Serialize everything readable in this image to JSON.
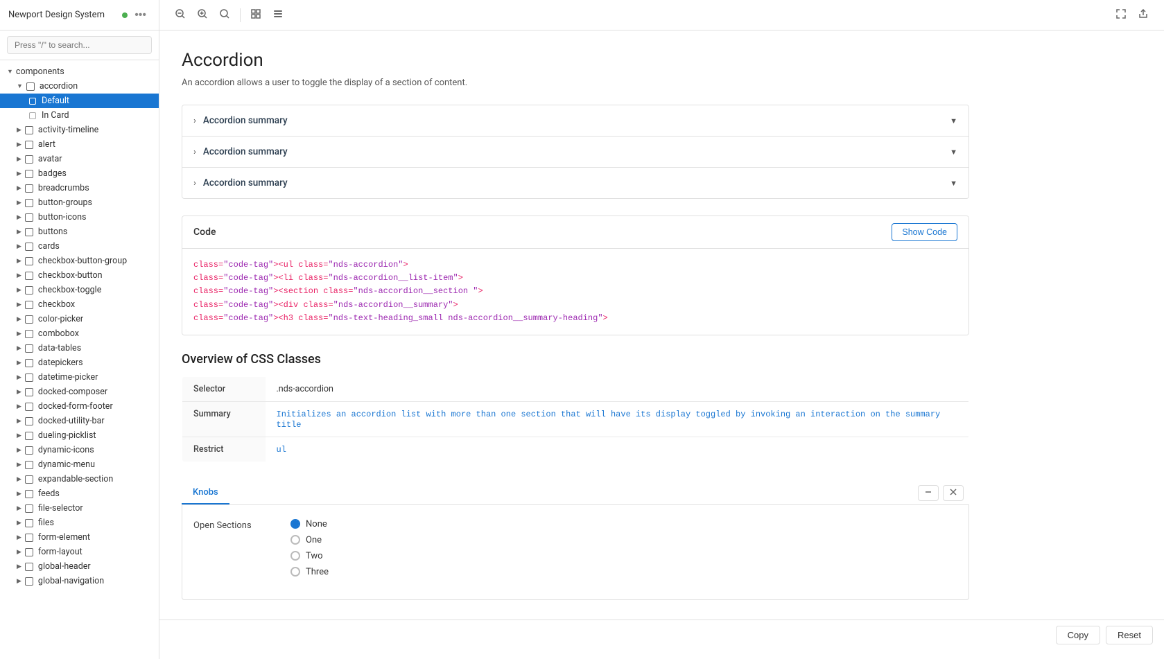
{
  "sidebar": {
    "title": "Newport Design System",
    "search_placeholder": "Press \"/\" to search...",
    "items": [
      {
        "id": "components",
        "label": "components",
        "level": 0,
        "type": "section",
        "expanded": true
      },
      {
        "id": "accordion",
        "label": "accordion",
        "level": 1,
        "type": "component",
        "expanded": true
      },
      {
        "id": "default",
        "label": "Default",
        "level": 2,
        "type": "story",
        "active": true
      },
      {
        "id": "in-card",
        "label": "In Card",
        "level": 2,
        "type": "story"
      },
      {
        "id": "activity-timeline",
        "label": "activity-timeline",
        "level": 1,
        "type": "component"
      },
      {
        "id": "alert",
        "label": "alert",
        "level": 1,
        "type": "component"
      },
      {
        "id": "avatar",
        "label": "avatar",
        "level": 1,
        "type": "component"
      },
      {
        "id": "badges",
        "label": "badges",
        "level": 1,
        "type": "component"
      },
      {
        "id": "breadcrumbs",
        "label": "breadcrumbs",
        "level": 1,
        "type": "component"
      },
      {
        "id": "button-groups",
        "label": "button-groups",
        "level": 1,
        "type": "component"
      },
      {
        "id": "button-icons",
        "label": "button-icons",
        "level": 1,
        "type": "component"
      },
      {
        "id": "buttons",
        "label": "buttons",
        "level": 1,
        "type": "component"
      },
      {
        "id": "cards",
        "label": "cards",
        "level": 1,
        "type": "component"
      },
      {
        "id": "checkbox-button-group",
        "label": "checkbox-button-group",
        "level": 1,
        "type": "component"
      },
      {
        "id": "checkbox-button",
        "label": "checkbox-button",
        "level": 1,
        "type": "component"
      },
      {
        "id": "checkbox-toggle",
        "label": "checkbox-toggle",
        "level": 1,
        "type": "component"
      },
      {
        "id": "checkbox",
        "label": "checkbox",
        "level": 1,
        "type": "component"
      },
      {
        "id": "color-picker",
        "label": "color-picker",
        "level": 1,
        "type": "component"
      },
      {
        "id": "combobox",
        "label": "combobox",
        "level": 1,
        "type": "component"
      },
      {
        "id": "data-tables",
        "label": "data-tables",
        "level": 1,
        "type": "component"
      },
      {
        "id": "datepickers",
        "label": "datepickers",
        "level": 1,
        "type": "component"
      },
      {
        "id": "datetime-picker",
        "label": "datetime-picker",
        "level": 1,
        "type": "component"
      },
      {
        "id": "docked-composer",
        "label": "docked-composer",
        "level": 1,
        "type": "component"
      },
      {
        "id": "docked-form-footer",
        "label": "docked-form-footer",
        "level": 1,
        "type": "component"
      },
      {
        "id": "docked-utility-bar",
        "label": "docked-utility-bar",
        "level": 1,
        "type": "component"
      },
      {
        "id": "dueling-picklist",
        "label": "dueling-picklist",
        "level": 1,
        "type": "component"
      },
      {
        "id": "dynamic-icons",
        "label": "dynamic-icons",
        "level": 1,
        "type": "component"
      },
      {
        "id": "dynamic-menu",
        "label": "dynamic-menu",
        "level": 1,
        "type": "component"
      },
      {
        "id": "expandable-section",
        "label": "expandable-section",
        "level": 1,
        "type": "component"
      },
      {
        "id": "feeds",
        "label": "feeds",
        "level": 1,
        "type": "component"
      },
      {
        "id": "file-selector",
        "label": "file-selector",
        "level": 1,
        "type": "component"
      },
      {
        "id": "files",
        "label": "files",
        "level": 1,
        "type": "component"
      },
      {
        "id": "form-element",
        "label": "form-element",
        "level": 1,
        "type": "component"
      },
      {
        "id": "form-layout",
        "label": "form-layout",
        "level": 1,
        "type": "component"
      },
      {
        "id": "global-header",
        "label": "global-header",
        "level": 1,
        "type": "component"
      },
      {
        "id": "global-navigation",
        "label": "global-navigation",
        "level": 1,
        "type": "component"
      }
    ]
  },
  "toolbar": {
    "zoom_in_title": "Zoom in",
    "zoom_out_title": "Zoom out",
    "zoom_reset_title": "Reset zoom",
    "grid_view_title": "Grid view",
    "list_view_title": "List view",
    "fullscreen_title": "Fullscreen",
    "share_title": "Share"
  },
  "page": {
    "title": "Accordion",
    "description": "An accordion allows a user to toggle the display of a section of content.",
    "accordion_items": [
      {
        "label": "Accordion summary"
      },
      {
        "label": "Accordion summary"
      },
      {
        "label": "Accordion summary"
      }
    ],
    "code_section_title": "Code",
    "show_code_btn": "Show Code",
    "code_lines": [
      {
        "indent": 0,
        "text": "<ul class=\"nds-accordion\">"
      },
      {
        "indent": 1,
        "text": "<li class=\"nds-accordion__list-item\">"
      },
      {
        "indent": 2,
        "text": "<section class=\"nds-accordion__section \">"
      },
      {
        "indent": 3,
        "text": "<div class=\"nds-accordion__summary\">"
      },
      {
        "indent": 4,
        "text": "<h3 class=\"nds-text-heading_small nds-accordion__summary-heading\">",
        "faded": true
      }
    ],
    "css_section_title": "Overview of CSS Classes",
    "css_table": [
      {
        "col1": "Selector",
        "col2": ".nds-accordion"
      },
      {
        "col1": "Summary",
        "col2": "Initializes an accordion list with more than one section that will have its display toggled by invoking an interaction on the summary title"
      },
      {
        "col1": "Restrict",
        "col2": "ul"
      }
    ],
    "knobs_tab_label": "Knobs",
    "open_sections_label": "Open Sections",
    "knob_options": [
      {
        "label": "None",
        "checked": true
      },
      {
        "label": "One",
        "checked": false
      },
      {
        "label": "Two",
        "checked": false
      },
      {
        "label": "Three",
        "checked": false
      }
    ],
    "copy_btn": "Copy",
    "reset_btn": "Reset"
  }
}
